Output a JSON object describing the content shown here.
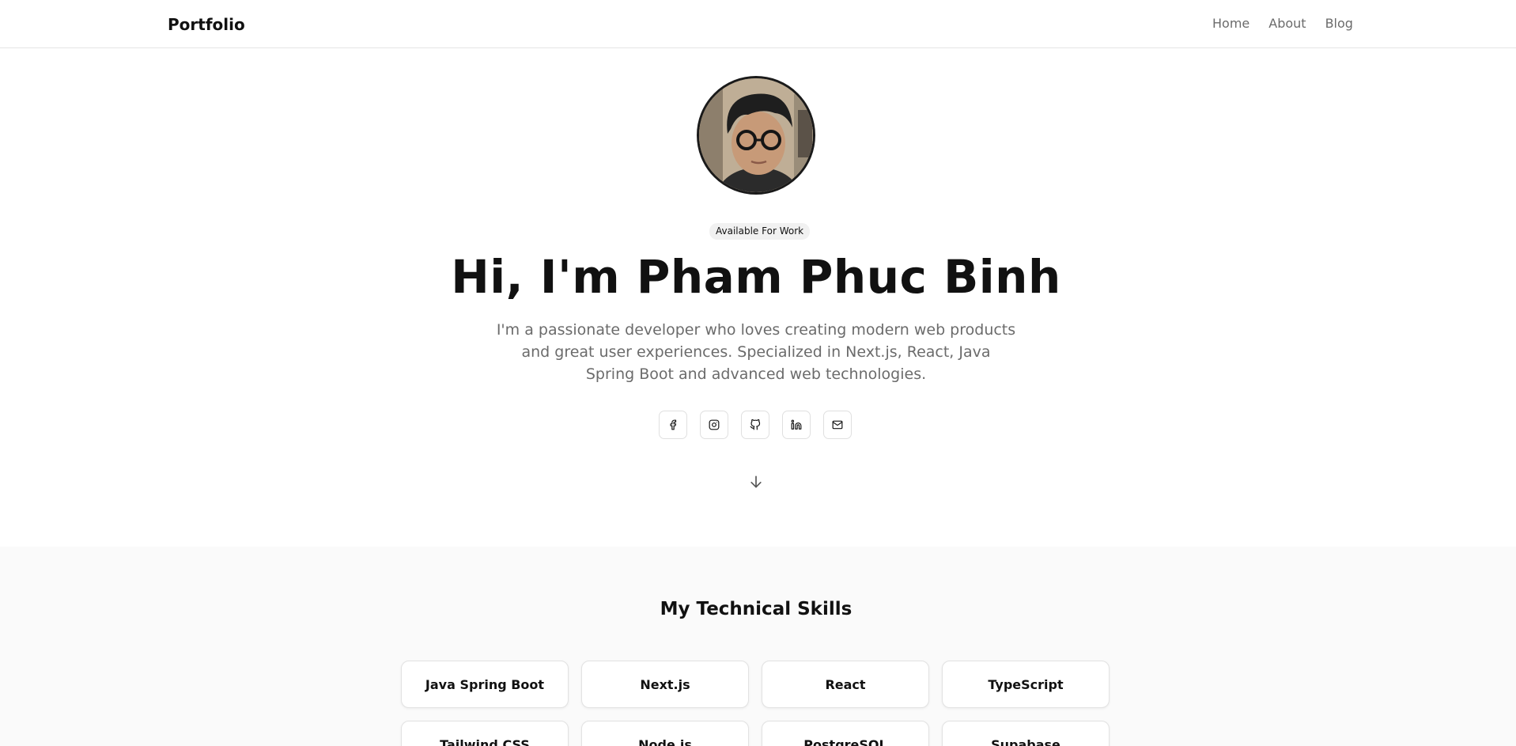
{
  "header": {
    "brand": "Portfolio",
    "nav": [
      {
        "label": "Home"
      },
      {
        "label": "About"
      },
      {
        "label": "Blog"
      }
    ]
  },
  "hero": {
    "badge": "Available For Work",
    "title": "Hi, I'm Pham Phuc Binh",
    "description": "I'm a passionate developer who loves creating modern web products and great user experiences. Specialized in Next.js, React, Java Spring Boot and advanced web technologies.",
    "socials": [
      {
        "icon": "facebook-icon"
      },
      {
        "icon": "instagram-icon"
      },
      {
        "icon": "github-icon"
      },
      {
        "icon": "linkedin-icon"
      },
      {
        "icon": "mail-icon"
      }
    ],
    "scroll_icon": "arrow-down-icon"
  },
  "skills": {
    "title": "My Technical Skills",
    "items": [
      {
        "label": "Java Spring Boot"
      },
      {
        "label": "Next.js"
      },
      {
        "label": "React"
      },
      {
        "label": "TypeScript"
      },
      {
        "label": "Tailwind CSS"
      },
      {
        "label": "Node.js"
      },
      {
        "label": "PostgreSQL"
      },
      {
        "label": "Supabase"
      }
    ]
  },
  "colors": {
    "text": "#111111",
    "muted": "#6b6b6b",
    "border": "#e2e2e2",
    "section_bg": "#fafafa"
  }
}
